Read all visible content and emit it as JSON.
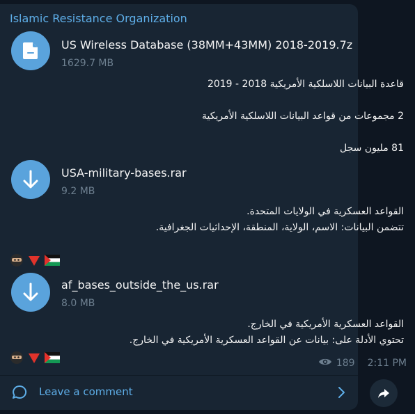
{
  "channel": {
    "name": "Islamic Resistance Organization"
  },
  "posts": [
    {
      "file_name": "US Wireless Database (38MM+43MM) 2018-2019.7z",
      "file_size": "1629.7 MB",
      "icon": "document-icon",
      "lines": [
        "قاعدة البيانات اللاسلكية الأمريكية 2018 - 2019",
        "2 مجموعات من قواعد البيانات اللاسلكية الأمريكية",
        "81 مليون سجل"
      ]
    },
    {
      "file_name": "USA-military-bases.rar",
      "file_size": "9.2 MB",
      "icon": "download-icon",
      "lines": [
        "القواعد العسكرية في الولايات المتحدة.",
        "تتضمن البيانات: الاسم، الولاية، المنطقة، الإحداثيات الجغرافية."
      ]
    },
    {
      "file_name": "af_bases_outside_the_us.rar",
      "file_size": "8.0 MB",
      "icon": "download-icon",
      "lines": [
        "القواعد العسكرية الأمريكية في الخارج.",
        "تحتوي الأدلة على: بيانات عن القواعد العسكرية الأمريكية في الخارج."
      ]
    }
  ],
  "emojis": [
    "ninja-emoji",
    "red-triangle-emoji",
    "palestine-flag-emoji"
  ],
  "meta": {
    "views": "189",
    "time": "2:11 PM"
  },
  "comment": {
    "label": "Leave a comment"
  },
  "colors": {
    "accent": "#5eaee8",
    "bubble": "#182533",
    "background": "#0e1621",
    "icon_bg": "#5aa3dc"
  }
}
